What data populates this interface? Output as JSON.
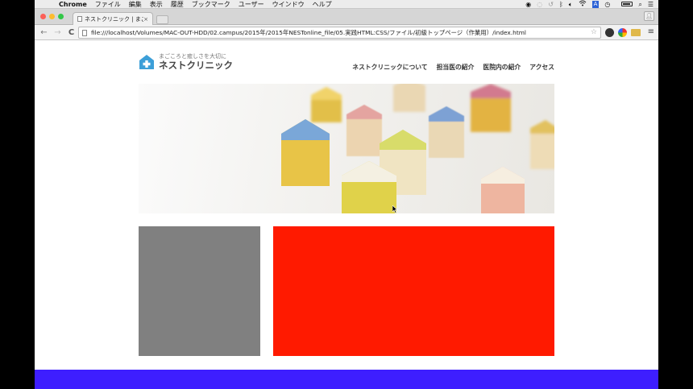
{
  "os_menu": {
    "app_name": "Chrome",
    "items": [
      "ファイル",
      "編集",
      "表示",
      "履歴",
      "ブックマーク",
      "ユーザー",
      "ウインドウ",
      "ヘルプ"
    ]
  },
  "browser": {
    "tab_title": "ネストクリニック | まごこ",
    "tab_close": "×",
    "url": "file:///localhost/Volumes/MAC-OUT-HDD/02.campus/2015年/2015年NESTonline_file/05.実践HTML:CSS/ファイル/初級トップページ（作業用）/index.html",
    "back_glyph": "←",
    "forward_glyph": "→",
    "reload_glyph": "C",
    "star_glyph": "☆",
    "menu_glyph": "≡"
  },
  "site": {
    "tagline": "まごころと癒しさを大切に",
    "name": "ネストクリニック",
    "nav": [
      "ネストクリニックについて",
      "担当医の紹介",
      "医院内の紹介",
      "アクセス"
    ]
  },
  "colors": {
    "gray_box": "#808080",
    "red_box": "#ff1a00",
    "footer_bar": "#3e1eff",
    "logo_blue": "#3c9fd8"
  }
}
